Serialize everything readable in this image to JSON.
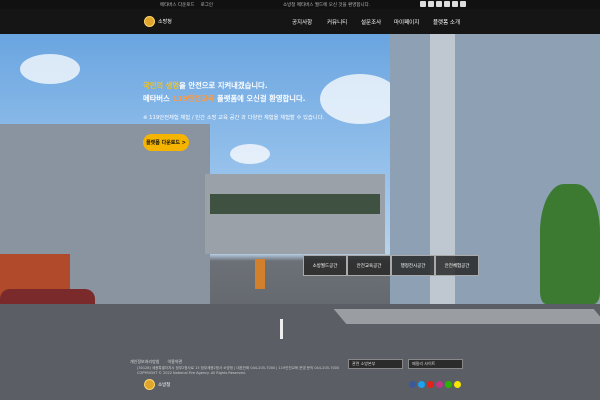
{
  "topbar": {
    "links": [
      "메타버스 다운로드",
      "로그인"
    ],
    "notice": "소방청 메타버스 월드에 오신 것을 환영합니다.",
    "sns": [
      "facebook-icon",
      "twitter-icon",
      "youtube-icon",
      "instagram-icon",
      "blog-icon",
      "pinterest-icon"
    ]
  },
  "nav": {
    "logo": "소방청",
    "items": [
      "공지사항",
      "커뮤니티",
      "설문조사",
      "마이페이지",
      "플랫폼 소개"
    ]
  },
  "hero": {
    "line1_highlight": "국민의 생명",
    "line1_rest": "을 안전으로 지켜내겠습니다.",
    "line2_prefix": "메타버스 ",
    "line2_highlight": "119안전교육",
    "line2_suffix": " 플랫폼에 오신걸 환영합니다.",
    "sub": "※ 119안전체험 체험 / 민간 소방 교육 공간 과 다양한 체험을 체험할 수 있습니다.",
    "button": "플랫폼 다운로드 >"
  },
  "tabs": [
    "소방월드공간",
    "안전교육공간",
    "행정전시공간",
    "안전체험공간"
  ],
  "footer": {
    "links": [
      "개인정보처리방침",
      "이용약관"
    ],
    "logo": "소방청",
    "address": "(30128) 세종특별자치시 정부2청사로 13 정부세종2청사 소방청 | 대표전화 044-205-7000 | 119안전교육 운영 문의 044-205-7000",
    "copyright": "COPYRIGHT © 2022 National Fire Agency. All Rights Reserved.",
    "select1": "관련 소방본부",
    "select2": "패밀리 사이트",
    "sns": [
      "facebook-icon",
      "twitter-icon",
      "youtube-icon",
      "instagram-icon",
      "blog-icon",
      "kakao-icon"
    ]
  },
  "colors": {
    "accent": "#f5b400",
    "nav_bg": "#151515"
  }
}
